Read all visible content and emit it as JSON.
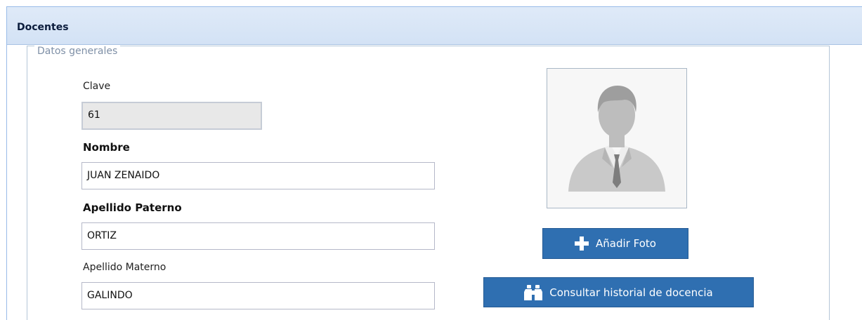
{
  "panel": {
    "title": "Docentes"
  },
  "section": {
    "legend": "Datos generales"
  },
  "fields": {
    "clave": {
      "label": "Clave",
      "value": "61"
    },
    "nombre": {
      "label": "Nombre",
      "value": "JUAN ZENAIDO"
    },
    "apellido_paterno": {
      "label": "Apellido Paterno",
      "value": "ORTIZ"
    },
    "apellido_materno": {
      "label": "Apellido Materno",
      "value": "GALINDO"
    }
  },
  "photo": {
    "icon": "avatar-placeholder-icon"
  },
  "buttons": {
    "add_photo": {
      "label": "Añadir Foto",
      "icon": "plus-icon"
    },
    "history": {
      "label": "Consultar historial de docencia",
      "icon": "binoculars-icon"
    }
  },
  "colors": {
    "header_bg": "#d3e2f5",
    "button_bg": "#2f6fb1",
    "readonly_bg": "#e8e8e8"
  }
}
